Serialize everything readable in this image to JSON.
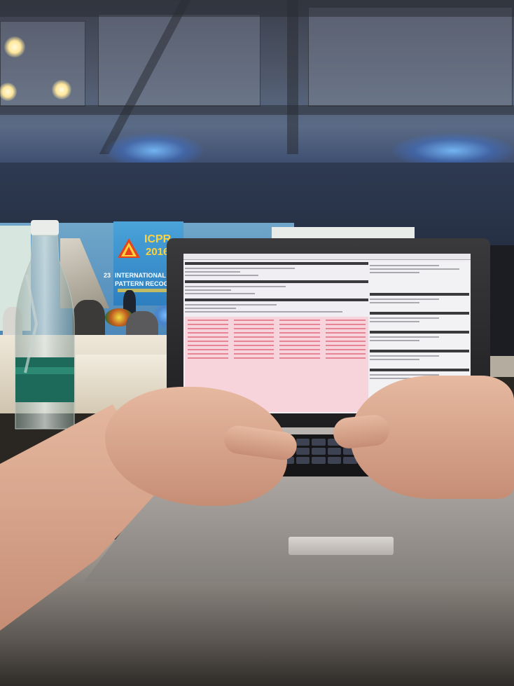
{
  "scene": {
    "description_label": "",
    "banner": {
      "logo_text": "ICPR",
      "year": "2016",
      "line_number": "23",
      "line1": "INTERNATIONAL CONFE",
      "line2": "PATTERN RECOGNITION"
    }
  },
  "colors": {
    "stage_blue": "#4a86b8",
    "banner_yellow": "#ffd23c",
    "terminal_red": "#e06a7e",
    "laptop_silver": "#bdb8b3"
  },
  "icons": {
    "logo": "icpr-pyramid-logo",
    "bottle": "water-bottle"
  }
}
